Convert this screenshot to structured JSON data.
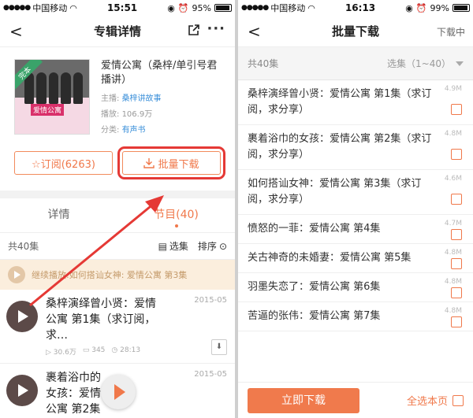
{
  "left": {
    "status": {
      "carrier": "中国移动",
      "time": "15:51",
      "battery": "95%"
    },
    "nav": {
      "back": "<",
      "title": "专辑详情",
      "more": "···"
    },
    "album": {
      "cover_ribbon": "完本",
      "cover_logo": "爱情公寓",
      "name": "爱情公寓（桑梓/单引号君播讲）",
      "host_label": "主播:",
      "host": "桑梓讲故事",
      "plays_label": "播放:",
      "plays": "106.9万",
      "category_label": "分类:",
      "category": "有声书"
    },
    "buttons": {
      "subscribe": "☆订阅(6263)",
      "batch_download": "批量下载"
    },
    "tabs": {
      "detail": "详情",
      "programs": "节目(40)"
    },
    "list_header": {
      "count": "共40集",
      "select": "选集",
      "sort": "排序"
    },
    "continue_text": "继续播放:如何搭讪女神:  爱情公寓 第3集",
    "episodes": [
      {
        "title": "桑梓演绎曾小贤：爱情公寓 第1集（求订阅，求…",
        "date": "2015-05",
        "plays": "30.6万",
        "comments": "345",
        "duration": "28:13"
      },
      {
        "title": "裹着浴巾的女孩：爱情公寓 第2集",
        "date": "2015-05"
      }
    ]
  },
  "right": {
    "status": {
      "carrier": "中国移动",
      "time": "16:13",
      "battery": "99%"
    },
    "nav": {
      "back": "<",
      "title": "批量下载",
      "downloading": "下载中"
    },
    "header": {
      "count": "共40集",
      "select": "选集（1~40）"
    },
    "items": [
      {
        "title": "桑梓演绎曾小贤：爱情公寓 第1集（求订阅，求分享）",
        "size": "4.9M"
      },
      {
        "title": "裹着浴巾的女孩：爱情公寓 第2集（求订阅，求分享）",
        "size": "4.8M"
      },
      {
        "title": "如何搭讪女神：爱情公寓 第3集（求订阅，求分享）",
        "size": "4.6M"
      },
      {
        "title": "愤怒的一菲：爱情公寓 第4集",
        "size": "4.7M"
      },
      {
        "title": "关古神奇的未婚妻：爱情公寓 第5集",
        "size": "4.8M"
      },
      {
        "title": "羽墨失恋了：爱情公寓 第6集",
        "size": "4.8M"
      },
      {
        "title": "苦逼的张伟：爱情公寓 第7集",
        "size": "4.8M"
      }
    ],
    "footer": {
      "download_now": "立即下载",
      "select_page": "全选本页"
    }
  },
  "colors": {
    "accent": "#f0784a",
    "highlight_box": "#e53935",
    "link": "#3a8fd9"
  }
}
